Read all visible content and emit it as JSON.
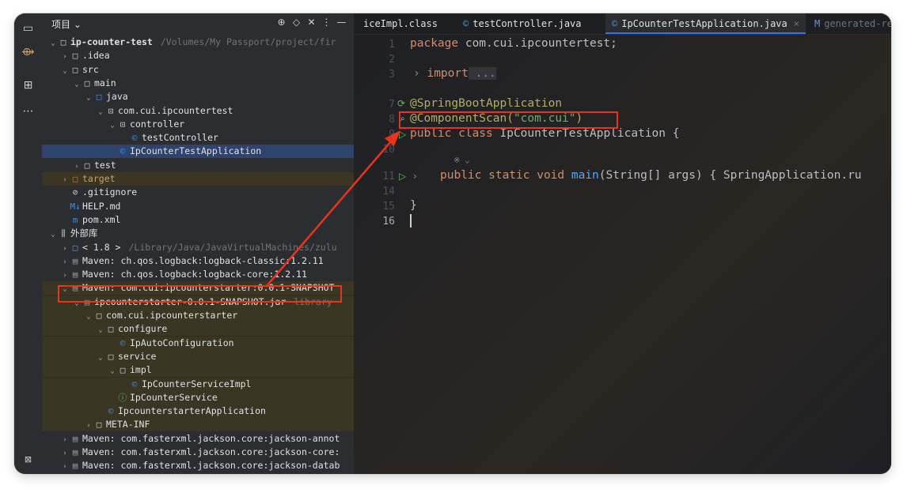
{
  "project_panel": {
    "title": "项目 ⌄",
    "tree": [
      {
        "depth": 0,
        "chev": "⌄",
        "icon": "□",
        "icon_class": "folder",
        "label": "ip-counter-test",
        "bold": true,
        "path": "/Volumes/My Passport/project/fir"
      },
      {
        "depth": 1,
        "chev": "›",
        "icon": "□",
        "icon_class": "folder",
        "label": ".idea"
      },
      {
        "depth": 1,
        "chev": "⌄",
        "icon": "□",
        "icon_class": "folder",
        "label": "src"
      },
      {
        "depth": 2,
        "chev": "⌄",
        "icon": "□",
        "icon_class": "folder",
        "label": "main"
      },
      {
        "depth": 3,
        "chev": "⌄",
        "icon": "□",
        "icon_class": "folder-blue",
        "label": "java"
      },
      {
        "depth": 4,
        "chev": "⌄",
        "icon": "⊡",
        "icon_class": "folder",
        "label": "com.cui.ipcountertest"
      },
      {
        "depth": 5,
        "chev": "⌄",
        "icon": "⊡",
        "icon_class": "folder",
        "label": "controller"
      },
      {
        "depth": 6,
        "chev": "",
        "icon": "©",
        "icon_class": "cls",
        "label": "testController"
      },
      {
        "depth": 5,
        "chev": "",
        "icon": "©",
        "icon_class": "cls",
        "label": "IpCounterTestApplication",
        "selected": true
      },
      {
        "depth": 2,
        "chev": "›",
        "icon": "□",
        "icon_class": "folder",
        "label": "test"
      },
      {
        "depth": 1,
        "chev": "›",
        "icon": "□",
        "icon_class": "folder-orange",
        "label": "target",
        "band": true
      },
      {
        "depth": 1,
        "chev": "",
        "icon": "⊘",
        "icon_class": "folder",
        "label": ".gitignore"
      },
      {
        "depth": 1,
        "chev": "",
        "icon": "M↓",
        "icon_class": "cls",
        "label": "HELP.md"
      },
      {
        "depth": 1,
        "chev": "",
        "icon": "m",
        "icon_class": "cls",
        "label": "pom.xml"
      },
      {
        "depth": 0,
        "chev": "⌄",
        "icon": "⫼",
        "icon_class": "folder",
        "label": "外部库"
      },
      {
        "depth": 1,
        "chev": "›",
        "icon": "□",
        "icon_class": "folder-blue",
        "label": "< 1.8 >",
        "path": "/Library/Java/JavaVirtualMachines/zulu"
      },
      {
        "depth": 1,
        "chev": "›",
        "icon": "▤",
        "icon_class": "jar",
        "label": "Maven: ch.qos.logback:logback-classic:1.2.11"
      },
      {
        "depth": 1,
        "chev": "›",
        "icon": "▤",
        "icon_class": "jar",
        "label": "Maven: ch.qos.logback:logback-core:1.2.11"
      },
      {
        "depth": 1,
        "chev": "⌄",
        "icon": "▤",
        "icon_class": "jar",
        "label": "Maven: com.cui:ipcounterstarter:0.0.1-SNAPSHOT",
        "band": true
      },
      {
        "depth": 2,
        "chev": "⌄",
        "icon": "▤",
        "icon_class": "jar",
        "label": "ipcounterstarter-0.0.1-SNAPSHOT.jar",
        "path": "library",
        "band": true
      },
      {
        "depth": 3,
        "chev": "⌄",
        "icon": "□",
        "icon_class": "folder",
        "label": "com.cui.ipcounterstarter",
        "band": true
      },
      {
        "depth": 4,
        "chev": "⌄",
        "icon": "□",
        "icon_class": "folder",
        "label": "configure",
        "band": true
      },
      {
        "depth": 5,
        "chev": "",
        "icon": "©",
        "icon_class": "cls",
        "label": "IpAutoConfiguration",
        "band": true
      },
      {
        "depth": 4,
        "chev": "⌄",
        "icon": "□",
        "icon_class": "folder",
        "label": "service",
        "band": true
      },
      {
        "depth": 5,
        "chev": "⌄",
        "icon": "□",
        "icon_class": "folder",
        "label": "impl",
        "band": true
      },
      {
        "depth": 6,
        "chev": "",
        "icon": "©",
        "icon_class": "cls",
        "label": "IpCounterServiceImpl",
        "band": true
      },
      {
        "depth": 5,
        "chev": "",
        "icon": "ⓘ",
        "icon_class": "iface",
        "label": "IpCounterService",
        "band": true
      },
      {
        "depth": 4,
        "chev": "",
        "icon": "©",
        "icon_class": "cls",
        "label": "IpcounterstarterApplication",
        "band": true
      },
      {
        "depth": 3,
        "chev": "›",
        "icon": "□",
        "icon_class": "folder",
        "label": "META-INF",
        "band": true
      },
      {
        "depth": 1,
        "chev": "›",
        "icon": "▤",
        "icon_class": "jar",
        "label": "Maven: com.fasterxml.jackson.core:jackson-annot"
      },
      {
        "depth": 1,
        "chev": "›",
        "icon": "▤",
        "icon_class": "jar",
        "label": "Maven: com.fasterxml.jackson.core:jackson-core:"
      },
      {
        "depth": 1,
        "chev": "›",
        "icon": "▤",
        "icon_class": "jar",
        "label": "Maven: com.fasterxml.jackson.core:jackson-datab"
      }
    ]
  },
  "tabs": [
    {
      "icon": "",
      "label": "iceImpl.class",
      "active": false
    },
    {
      "icon": "©",
      "label": "testController.java",
      "active": false
    },
    {
      "icon": "©",
      "label": "IpCounterTestApplication.java",
      "active": true,
      "close": "×"
    },
    {
      "icon": "M",
      "label": "generated-re",
      "active": false
    }
  ],
  "editor": {
    "line_numbers": [
      "1",
      "2",
      "3",
      "7",
      "8",
      "9",
      "10",
      "11",
      "14",
      "15",
      "16"
    ],
    "lines": {
      "l1_kw": "package",
      "l1_rest": " com.cui.ipcountertest;",
      "l3_fold": "›",
      "l3_kw": "import",
      "l3_rest": " ...",
      "l7_ann": "@SpringBootApplication",
      "l8_ann": "@ComponentScan(",
      "l8_str": "\"com.cui\"",
      "l8_close": ")",
      "l9_kw": "public class",
      "l9_rest": " IpCounterTestApplication {",
      "hint": "※ ⌄",
      "l11_kw": "public static void",
      "l11_fn": " main",
      "l11_rest": "(String[] args) { SpringApplication.ru",
      "l15": "}"
    }
  },
  "colors": {
    "highlight_box": "#e8331f",
    "arrow": "#e8331f"
  }
}
